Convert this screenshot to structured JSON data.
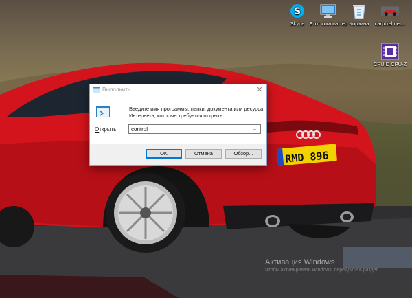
{
  "desktop": {
    "icons": [
      {
        "label": "Skype",
        "icon": "skype-icon",
        "color": "#00aff0"
      },
      {
        "label": "Этот компьютер",
        "icon": "this-pc-icon",
        "color": "#4aa3df"
      },
      {
        "label": "Корзина",
        "icon": "recycle-bin-icon",
        "color": "#d8e6f0"
      },
      {
        "label": "carpixel.net...",
        "icon": "image-file-icon",
        "color": "#c62828"
      },
      {
        "label": "CPUID CPU-Z",
        "icon": "cpu-z-icon",
        "color": "#5b2ea6"
      }
    ]
  },
  "run_dialog": {
    "title": "Выполнить",
    "description": "Введите имя программы, папки, документа или ресурса Интернета, которые требуется открыть.",
    "open_label_prefix": "О",
    "open_label_rest": "ткрыть:",
    "open_value": "control",
    "buttons": {
      "ok": "OK",
      "cancel": "Отмена",
      "browse": "Обзор..."
    }
  },
  "watermark": {
    "title": "Активация Windows",
    "subtitle": "Чтобы активировать Windows, перейдите в раздел"
  },
  "wallpaper": {
    "plate_text": "RMD 896",
    "car_color": "#d3141c"
  }
}
